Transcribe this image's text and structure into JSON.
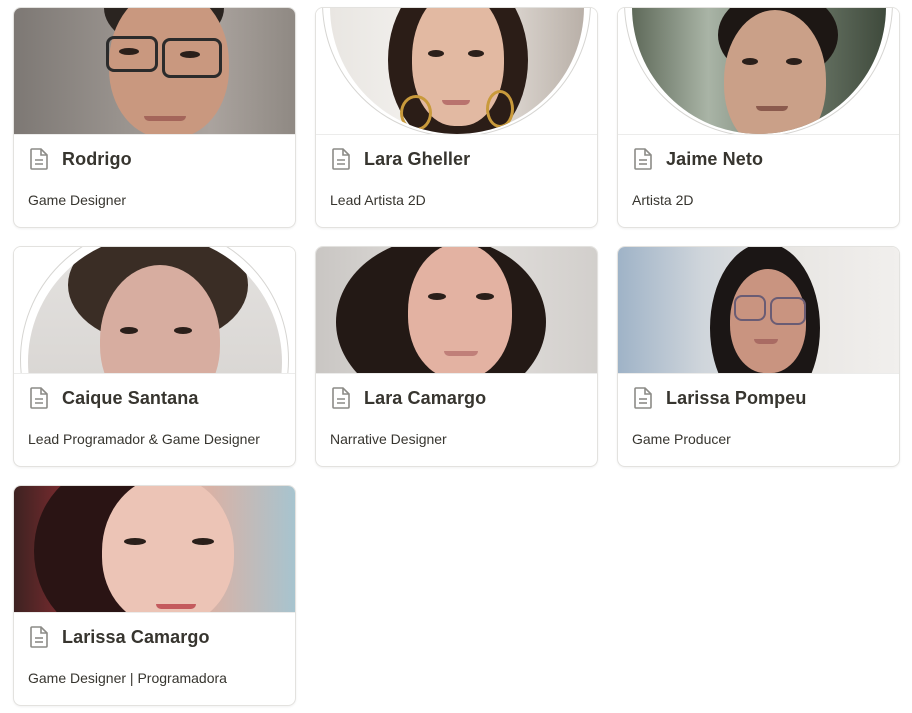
{
  "cards": [
    {
      "name": "Rodrigo",
      "role": "Game Designer",
      "icon": "page-icon"
    },
    {
      "name": "Lara Gheller",
      "role": "Lead Artista 2D",
      "icon": "page-icon"
    },
    {
      "name": "Jaime Neto",
      "role": "Artista 2D",
      "icon": "page-icon"
    },
    {
      "name": "Caique Santana",
      "role": "Lead Programador & Game Designer",
      "icon": "page-icon"
    },
    {
      "name": "Lara Camargo",
      "role": "Narrative Designer",
      "icon": "page-icon"
    },
    {
      "name": "Larissa Pompeu",
      "role": "Game Producer",
      "icon": "page-icon"
    },
    {
      "name": "Larissa Camargo",
      "role": "Game Designer | Programadora",
      "icon": "page-icon"
    }
  ],
  "colors": {
    "card_border": "#e3e2df",
    "text": "#37352f",
    "icon": "#8c8b87"
  }
}
